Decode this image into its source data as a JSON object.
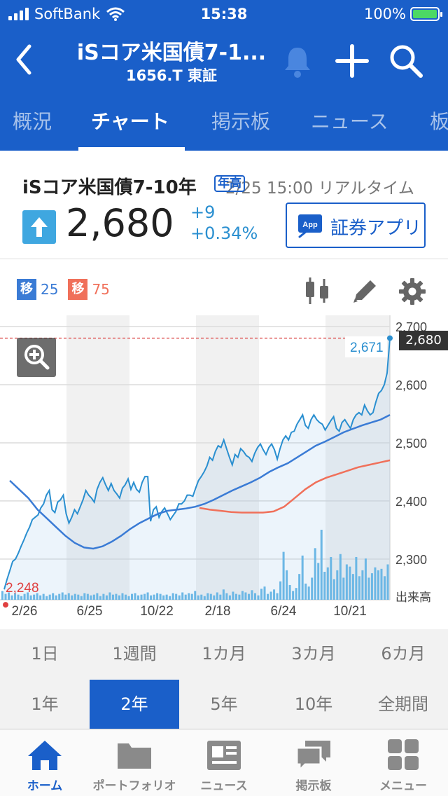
{
  "status": {
    "carrier": "SoftBank",
    "time": "15:38",
    "battery": "100%"
  },
  "nav": {
    "title": "iSコア米国債7-1...",
    "subtitle": "1656.T 東証"
  },
  "tabs": [
    "概況",
    "チャート",
    "掲示板",
    "ニュース",
    "板"
  ],
  "active_tab": 1,
  "quote": {
    "name": "iSコア米国債7-10年",
    "badge": "年高",
    "timestamp": "2/25 15:00 リアルタイム",
    "price": "2,680",
    "change": "+9",
    "change_pct": "+0.34%",
    "app_icon_text": "App",
    "app_button": "証券アプリ"
  },
  "ma": {
    "short": {
      "tag": "移",
      "value": "25",
      "color": "#3a7bd5"
    },
    "long": {
      "tag": "移",
      "value": "75",
      "color": "#f0705a"
    }
  },
  "chart_data": {
    "type": "line",
    "x_labels": [
      "2/26",
      "6/25",
      "10/22",
      "2/18",
      "6/24",
      "10/21"
    ],
    "y_ticks": [
      "2,700",
      "2,600",
      "2,500",
      "2,400",
      "2,300"
    ],
    "ylim": [
      2230,
      2700
    ],
    "volume_label": "出来高",
    "last_value_label": "2,680",
    "last_value": 2680,
    "ref_line_value": 2680,
    "high_label": "2,671",
    "high_value": 2671,
    "low_label": "2,248",
    "low_value": 2248,
    "price_series": [
      2248,
      2265,
      2280,
      2296,
      2300,
      2310,
      2322,
      2333,
      2345,
      2355,
      2368,
      2372,
      2376,
      2388,
      2395,
      2410,
      2418,
      2385,
      2380,
      2398,
      2402,
      2410,
      2378,
      2362,
      2372,
      2385,
      2378,
      2390,
      2402,
      2418,
      2410,
      2405,
      2398,
      2420,
      2432,
      2440,
      2428,
      2418,
      2430,
      2418,
      2412,
      2405,
      2422,
      2428,
      2438,
      2420,
      2432,
      2420,
      2415,
      2432,
      2442,
      2442,
      2365,
      2385,
      2390,
      2372,
      2382,
      2388,
      2378,
      2368,
      2375,
      2382,
      2395,
      2395,
      2400,
      2410,
      2410,
      2408,
      2422,
      2435,
      2442,
      2450,
      2460,
      2475,
      2470,
      2485,
      2495,
      2492,
      2505,
      2490,
      2475,
      2462,
      2480,
      2475,
      2490,
      2485,
      2478,
      2475,
      2468,
      2482,
      2492,
      2498,
      2488,
      2480,
      2492,
      2498,
      2488,
      2472,
      2490,
      2505,
      2512,
      2505,
      2518,
      2520,
      2532,
      2540,
      2548,
      2530,
      2525,
      2540,
      2548,
      2540,
      2535,
      2532,
      2522,
      2530,
      2538,
      2545,
      2525,
      2520,
      2535,
      2540,
      2532,
      2525,
      2540,
      2548,
      2552,
      2548,
      2565,
      2555,
      2548,
      2552,
      2570,
      2585,
      2590,
      2600,
      2620,
      2680
    ],
    "ma25_series": [
      2435,
      2420,
      2405,
      2385,
      2370,
      2355,
      2340,
      2328,
      2320,
      2318,
      2322,
      2330,
      2340,
      2352,
      2362,
      2370,
      2378,
      2383,
      2385,
      2387,
      2390,
      2395,
      2402,
      2410,
      2418,
      2425,
      2432,
      2440,
      2450,
      2458,
      2465,
      2475,
      2485,
      2495,
      2502,
      2510,
      2518,
      2524,
      2530,
      2535,
      2540,
      2548
    ],
    "ma75_series": [
      2388,
      2385,
      2383,
      2381,
      2380,
      2380,
      2380,
      2382,
      2390,
      2405,
      2420,
      2432,
      2440,
      2446,
      2452,
      2458,
      2462,
      2466,
      2470
    ],
    "volume_series": [
      12,
      8,
      10,
      6,
      9,
      7,
      5,
      8,
      10,
      6,
      7,
      9,
      6,
      8,
      5,
      7,
      9,
      6,
      8,
      10,
      7,
      9,
      6,
      8,
      7,
      5,
      9,
      8,
      6,
      7,
      9,
      5,
      8,
      6,
      10,
      7,
      8,
      6,
      9,
      7,
      5,
      8,
      9,
      6,
      7,
      8,
      10,
      6,
      7,
      9,
      8,
      6,
      7,
      5,
      9,
      8,
      6,
      10,
      7,
      9,
      8,
      12,
      6,
      7,
      5,
      9,
      8,
      6,
      10,
      7,
      14,
      9,
      6,
      11,
      8,
      7,
      12,
      10,
      8,
      13,
      9,
      6,
      15,
      18,
      8,
      11,
      14,
      9,
      25,
      65,
      40,
      20,
      12,
      16,
      35,
      60,
      22,
      18,
      30,
      70,
      50,
      95,
      38,
      44,
      58,
      28,
      40,
      62,
      30,
      48,
      45,
      35,
      58,
      32,
      40,
      56,
      30,
      36,
      44,
      40,
      42,
      32,
      48
    ],
    "grid": true
  },
  "periods_row1": [
    "1日",
    "1週間",
    "1カ月",
    "3カ月",
    "6カ月"
  ],
  "periods_row2": [
    "1年",
    "2年",
    "5年",
    "10年",
    "全期間"
  ],
  "active_period_row2": 1,
  "bottom_nav": [
    "ホーム",
    "ポートフォリオ",
    "ニュース",
    "掲示板",
    "メニュー"
  ],
  "bottom_active": 0,
  "colors": {
    "header": "#1a5fc9",
    "price_line": "#2a8fd0",
    "ma25": "#3a7bd5",
    "ma75": "#f0705a",
    "volume": "#6ab8e6",
    "ref_line": "#e06060"
  }
}
